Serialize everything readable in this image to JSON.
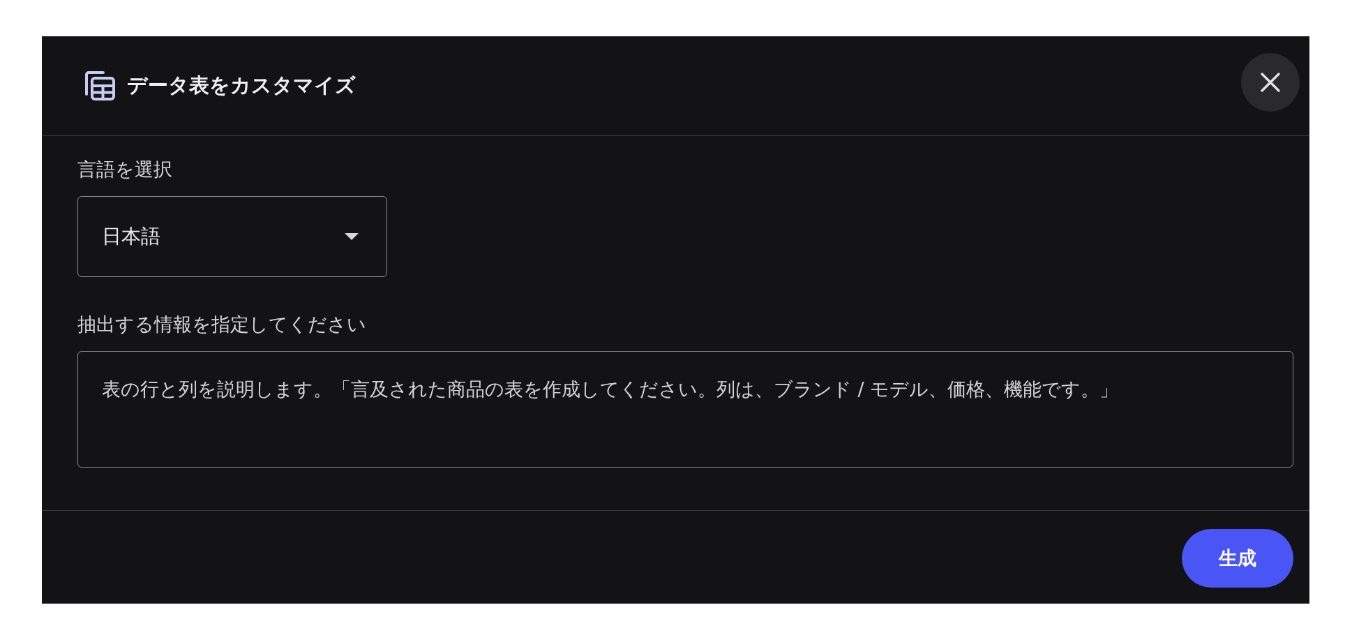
{
  "dialog": {
    "title": "データ表をカスタマイズ"
  },
  "language": {
    "label": "言語を選択",
    "value": "日本語"
  },
  "instructions": {
    "label": "抽出する情報を指定してください",
    "value": "表の行と列を説明します。「言及された商品の表を作成してください。列は、ブランド / モデル、価格、機能です。」"
  },
  "buttons": {
    "generate": "生成"
  }
}
